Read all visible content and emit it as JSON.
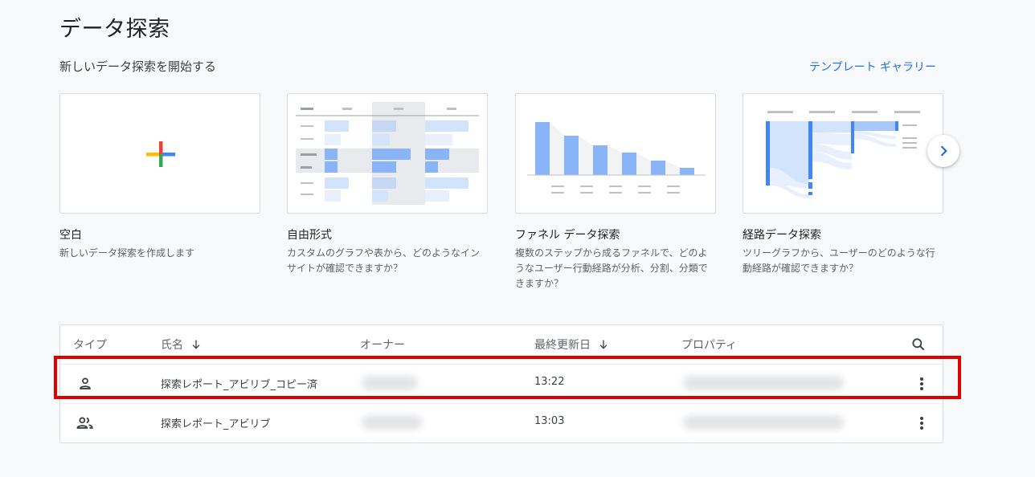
{
  "page": {
    "title": "データ探索",
    "section_title": "新しいデータ探索を開始する",
    "gallery_link": "テンプレート ギャラリー"
  },
  "cards": [
    {
      "name": "空白",
      "desc": "新しいデータ探索を作成します",
      "icon": "plus-icon"
    },
    {
      "name": "自由形式",
      "desc": "カスタムのグラフや表から、どのようなインサイトが確認できますか？",
      "icon": "table-thumbnail"
    },
    {
      "name": "ファネル データ探索",
      "desc": "複数のステップから成るファネルで、どのようなユーザー行動経路が分析、分割、分類できますか？",
      "icon": "funnel-thumbnail"
    },
    {
      "name": "経路データ探索",
      "desc": "ツリーグラフから、ユーザーのどのような行動経路が確認できますか？",
      "icon": "path-thumbnail"
    }
  ],
  "table": {
    "headers": {
      "type": "タイプ",
      "name": "氏名",
      "owner": "オーナー",
      "updated": "最終更新日",
      "property": "プロパティ"
    },
    "rows": [
      {
        "type_icon": "person-icon",
        "name": "探索レポート_アビリブ_コピー済",
        "updated": "13:22"
      },
      {
        "type_icon": "people-icon",
        "name": "探索レポート_アビリブ",
        "updated": "13:03"
      }
    ]
  },
  "colors": {
    "accent": "#1a73e8",
    "highlight": "#e00000",
    "bar_blue": "#8ab4f8",
    "bar_light": "#d2e3fc"
  }
}
